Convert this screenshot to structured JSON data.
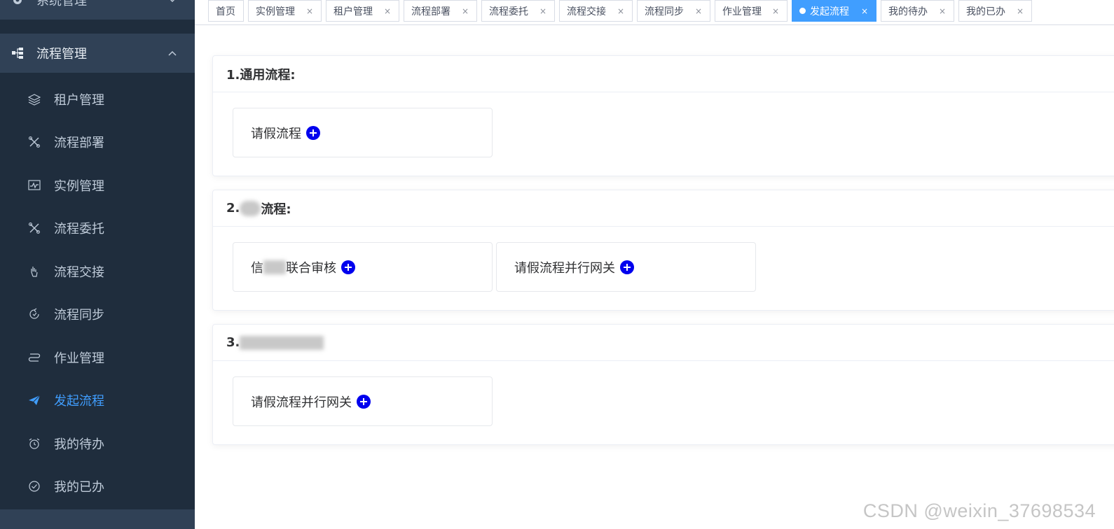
{
  "sidebar": {
    "system_menu": "系统管理",
    "flow_menu": "流程管理",
    "items": [
      {
        "label": "租户管理",
        "icon": "layers-icon"
      },
      {
        "label": "流程部署",
        "icon": "tools-icon"
      },
      {
        "label": "实例管理",
        "icon": "monitor-icon"
      },
      {
        "label": "流程委托",
        "icon": "tools-icon"
      },
      {
        "label": "流程交接",
        "icon": "hand-icon"
      },
      {
        "label": "流程同步",
        "icon": "sync-icon"
      },
      {
        "label": "作业管理",
        "icon": "job-icon"
      },
      {
        "label": "发起流程",
        "icon": "send-icon",
        "active": true
      },
      {
        "label": "我的待办",
        "icon": "alarm-clock-icon"
      },
      {
        "label": "我的已办",
        "icon": "check-circle-icon"
      }
    ]
  },
  "tags": [
    {
      "label": "首页",
      "closable": false
    },
    {
      "label": "实例管理",
      "closable": true
    },
    {
      "label": "租户管理",
      "closable": true
    },
    {
      "label": "流程部署",
      "closable": true
    },
    {
      "label": "流程委托",
      "closable": true
    },
    {
      "label": "流程交接",
      "closable": true
    },
    {
      "label": "流程同步",
      "closable": true
    },
    {
      "label": "作业管理",
      "closable": true
    },
    {
      "label": "发起流程",
      "closable": true,
      "active": true
    },
    {
      "label": "我的待办",
      "closable": true
    },
    {
      "label": "我的已办",
      "closable": true
    }
  ],
  "close_symbol": "×",
  "sections": [
    {
      "title": "1.通用流程:",
      "processes": [
        "请假流程"
      ]
    },
    {
      "title_prefix": "2.",
      "title_suffix": "流程:",
      "processes": [
        "联合审核",
        "请假流程并行网关"
      ],
      "first_process_prefix": "信"
    },
    {
      "title_prefix": "3.",
      "processes": [
        "请假流程并行网关"
      ]
    }
  ],
  "watermark": "CSDN @weixin_37698534",
  "colors": {
    "sidebar_bg": "#1f2d3d",
    "sidebar_header_bg": "#304156",
    "accent": "#409eff",
    "plus_icon": "#0000ee"
  }
}
